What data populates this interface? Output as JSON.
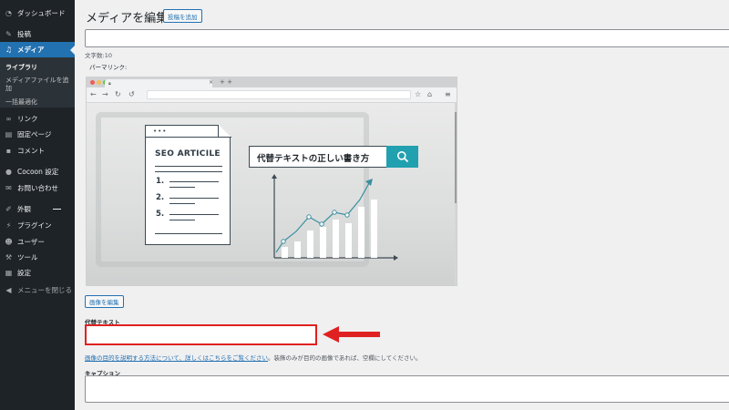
{
  "sidebar": {
    "items": [
      {
        "label": "ダッシュボード",
        "icon": "dashboard-icon"
      },
      {
        "label": "投稿",
        "icon": "pin-icon"
      },
      {
        "label": "メディア",
        "icon": "media-icon"
      },
      {
        "label": "リンク",
        "icon": "link-icon"
      },
      {
        "label": "固定ページ",
        "icon": "page-icon"
      },
      {
        "label": "コメント",
        "icon": "comment-icon"
      },
      {
        "label": "Cocoon 設定",
        "icon": "cocoon-icon"
      },
      {
        "label": "お問い合わせ",
        "icon": "mail-icon"
      },
      {
        "label": "外観",
        "icon": "brush-icon"
      },
      {
        "label": "プラグイン",
        "icon": "plugin-icon"
      },
      {
        "label": "ユーザー",
        "icon": "user-icon"
      },
      {
        "label": "ツール",
        "icon": "wrench-icon"
      },
      {
        "label": "設定",
        "icon": "settings-icon"
      }
    ],
    "submenu": {
      "library": "ライブラリ",
      "add_new_line1": "メディアファイルを追",
      "add_new_line2": "加",
      "bulk_optimize": "一括最適化"
    },
    "collapse_label": "メニューを閉じる",
    "active_color": "#2271b1"
  },
  "main": {
    "title": "メディアを編集",
    "add_button": "投稿を追加",
    "char_count": "文字数:10",
    "permalink": "パーマリンク:",
    "image": {
      "doc_heading": "SEO ARTICILE",
      "list_numbers": [
        "1.",
        "2.",
        "5."
      ],
      "search_text": "代替テキストの正しい書き方",
      "accent_color": "#21a1b0"
    },
    "edit_image_button": "画像を編集",
    "alt_label": "代替テキスト",
    "alt_value": "",
    "help_link": "画像の目的を説明する方法について、詳しくはこちらをご覧ください",
    "help_suffix": "。装飾のみが目的の画像であれば、空欄にしてください。",
    "caption_label": "キャプション",
    "caption_value": "",
    "highlight_color": "#e02121"
  }
}
